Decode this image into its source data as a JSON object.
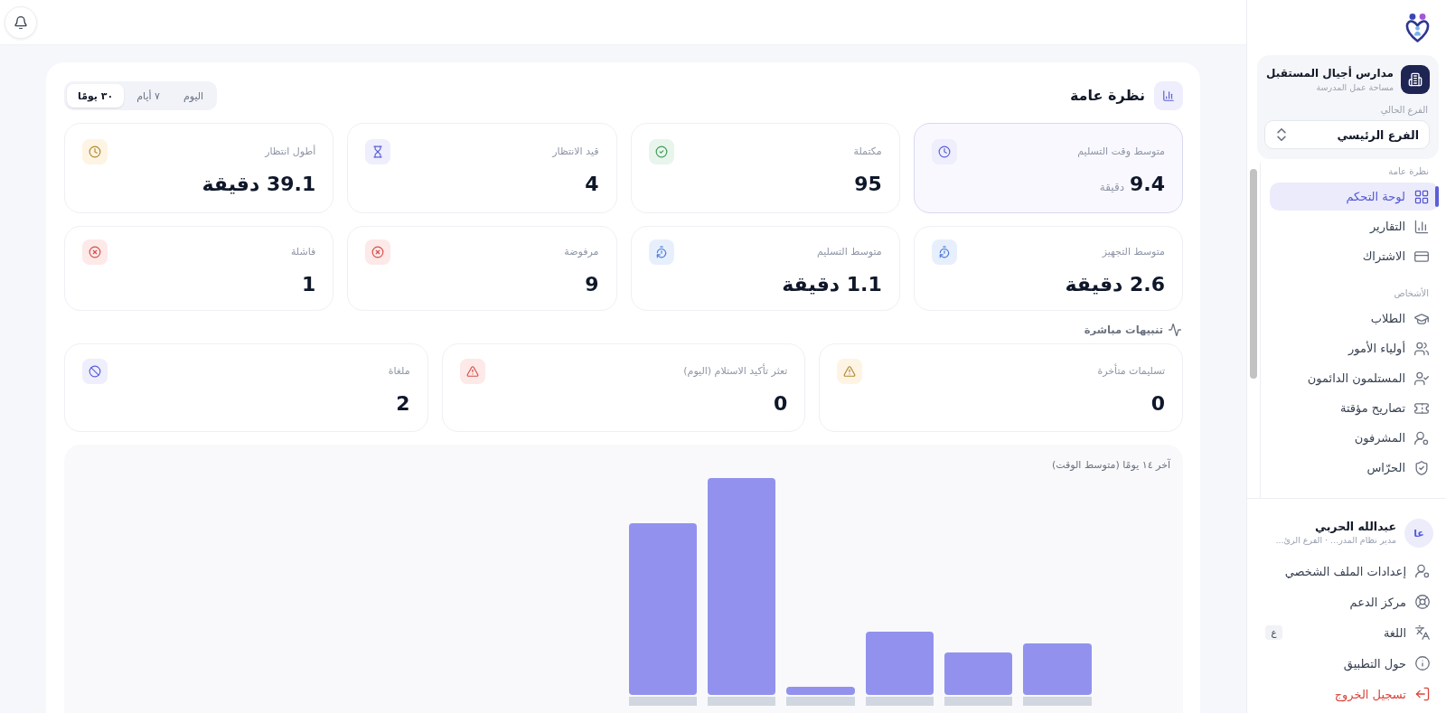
{
  "overview": {
    "title": "نظرة عامة",
    "periods": [
      {
        "label": "اليوم",
        "selected": false
      },
      {
        "label": "٧ أيام",
        "selected": false
      },
      {
        "label": "٣٠ يومًا",
        "selected": true
      }
    ],
    "stat_cards": [
      {
        "label": "متوسط وقت التسليم",
        "value": "9.4",
        "unit": "دقيقة",
        "kind": "primary",
        "highlighted": true
      },
      {
        "label": "مكتملة",
        "value": "95",
        "kind": "success",
        "highlighted": false
      },
      {
        "label": "قيد الانتظار",
        "value": "4",
        "kind": "primary",
        "highlighted": false
      },
      {
        "label": "أطول انتظار",
        "value": "39.1 دقيقة",
        "kind": "warning",
        "highlighted": false
      },
      {
        "label": "متوسط التجهيز",
        "value": "2.6 دقيقة",
        "kind": "info",
        "highlighted": false
      },
      {
        "label": "متوسط التسليم",
        "value": "1.1 دقيقة",
        "kind": "info",
        "highlighted": false
      },
      {
        "label": "مرفوضة",
        "value": "9",
        "kind": "danger",
        "highlighted": false
      },
      {
        "label": "فاشلة",
        "value": "1",
        "kind": "danger",
        "highlighted": false
      }
    ]
  },
  "alerts": {
    "title": "تنبيهات مباشرة",
    "cards": [
      {
        "label": "تسليمات متأخرة",
        "value": "0",
        "kind": "warning"
      },
      {
        "label": "تعثر تأكيد الاستلام (اليوم)",
        "value": "0",
        "kind": "danger"
      },
      {
        "label": "ملغاة",
        "value": "2",
        "kind": "primary"
      }
    ]
  },
  "chart": {
    "title": "آخر ١٤ يومًا (متوسط الوقت)"
  },
  "sidebar": {
    "workspace": {
      "name": "مدارس أجيال المستقبل",
      "subtitle": "مساحة عمل المدرسة"
    },
    "branch": {
      "label": "الفرع الحالي",
      "value": "الفرع الرئيسي"
    },
    "sections": [
      {
        "title": "نظرة عامة",
        "items": [
          {
            "label": "لوحة التحكم",
            "selected": true
          },
          {
            "label": "التقارير",
            "selected": false
          },
          {
            "label": "الاشتراك",
            "selected": false
          }
        ]
      },
      {
        "title": "الأشخاص",
        "items": [
          {
            "label": "الطلاب",
            "selected": false
          },
          {
            "label": "أولياء الأمور",
            "selected": false
          },
          {
            "label": "المستلمون الدائمون",
            "selected": false
          },
          {
            "label": "تصاريح مؤقتة",
            "selected": false
          },
          {
            "label": "المشرفون",
            "selected": false
          },
          {
            "label": "الحرّاس",
            "selected": false
          }
        ]
      }
    ],
    "user": {
      "initials": "عا",
      "name": "عبدالله الحربي",
      "subtitle": "مدير نظام المدر... · الفرع الرئ..."
    },
    "menu": [
      {
        "label": "إعدادات الملف الشخصي",
        "kind": "normal"
      },
      {
        "label": "مركز الدعم",
        "kind": "normal"
      },
      {
        "label": "اللغة",
        "kind": "normal",
        "badge": "ع"
      },
      {
        "label": "حول التطبيق",
        "kind": "normal"
      },
      {
        "label": "تسجيل الخروج",
        "kind": "danger"
      }
    ]
  }
}
